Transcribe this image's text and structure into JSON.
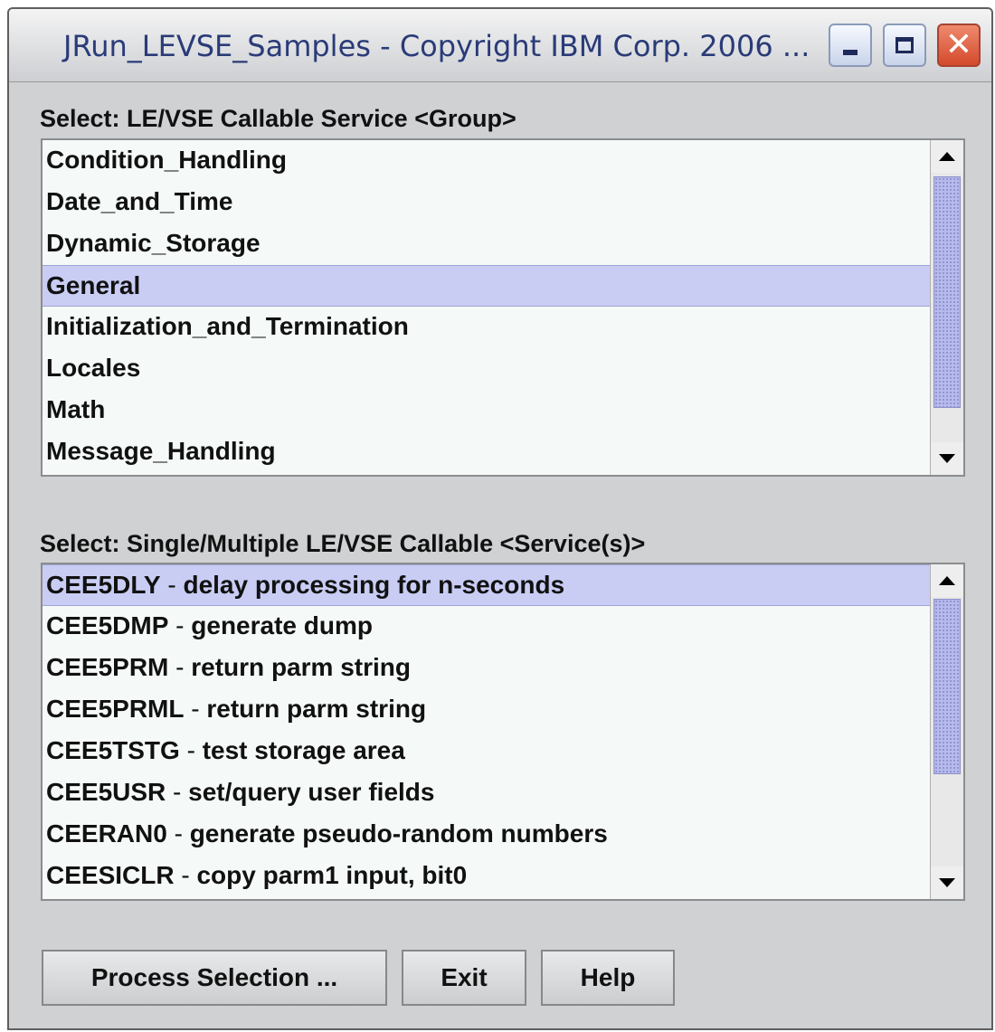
{
  "window": {
    "title": "JRun_LEVSE_Samples - Copyright IBM Corp. 2006 ...",
    "controls": {
      "minimize_icon": "minimize-icon",
      "maximize_icon": "maximize-icon",
      "close_icon": "close-icon",
      "close_glyph": "✕"
    }
  },
  "group_section": {
    "label": "Select:  LE/VSE Callable Service <Group>",
    "items": [
      "Condition_Handling",
      "Date_and_Time",
      "Dynamic_Storage",
      "General",
      "Initialization_and_Termination",
      "Locales",
      "Math",
      "Message_Handling"
    ],
    "selected_index": 3
  },
  "service_section": {
    "label": "Select:  Single/Multiple LE/VSE Callable <Service(s)>",
    "items": [
      {
        "code": "CEE5DLY",
        "description": "delay processing for n-seconds"
      },
      {
        "code": "CEE5DMP",
        "description": "generate dump"
      },
      {
        "code": "CEE5PRM",
        "description": "return parm string"
      },
      {
        "code": "CEE5PRML",
        "description": "return parm string"
      },
      {
        "code": "CEE5TSTG",
        "description": "test storage area"
      },
      {
        "code": "CEE5USR",
        "description": "set/query user fields"
      },
      {
        "code": "CEERAN0",
        "description": "generate pseudo-random numbers"
      },
      {
        "code": "CEESICLR",
        "description": "copy parm1 input, bit0"
      }
    ],
    "selected_index": 0,
    "separator": " - "
  },
  "buttons": {
    "process": "Process Selection ...",
    "exit": "Exit",
    "help": "Help"
  },
  "colors": {
    "selection": "#c9cdf4",
    "title_text": "#2a3b78",
    "window_bg": "#cfd1d3"
  }
}
